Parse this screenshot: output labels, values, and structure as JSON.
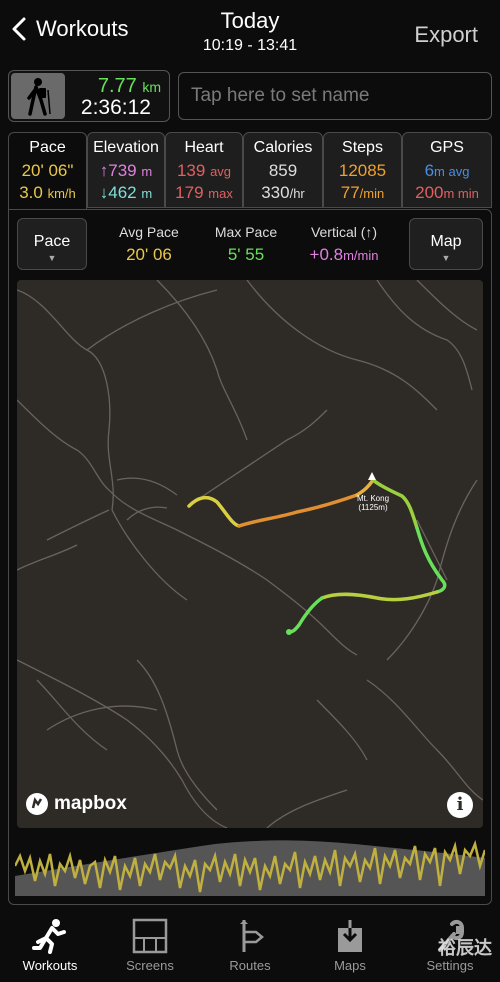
{
  "nav": {
    "back_label": "Workouts",
    "title": "Today",
    "time_range": "10:19 - 13:41",
    "export_label": "Export"
  },
  "summary": {
    "distance": "7.77",
    "distance_unit": "km",
    "duration": "2:36:12",
    "name_placeholder": "Tap here to set name"
  },
  "tabs": [
    {
      "title": "Pace",
      "l1": "20' 06\"",
      "l1_unit": "",
      "l2": "3.0",
      "l2_unit": "km/h"
    },
    {
      "title": "Elevation",
      "l1": "↑739",
      "l1_unit": "m",
      "l2": "↓462",
      "l2_unit": "m"
    },
    {
      "title": "Heart",
      "l1": "139",
      "l1_unit": "avg",
      "l2": "179",
      "l2_unit": "max"
    },
    {
      "title": "Calories",
      "l1": "859",
      "l1_unit": "",
      "l2": "330",
      "l2_unit": "/hr"
    },
    {
      "title": "Steps",
      "l1": "12085",
      "l1_unit": "",
      "l2": "77",
      "l2_unit": "/min"
    },
    {
      "title": "GPS",
      "l1": "6",
      "l1_unit": "m avg",
      "l2": "200",
      "l2_unit": "m min"
    }
  ],
  "panel": {
    "left_selector": "Pace",
    "right_selector": "Map",
    "avg_pace_label": "Avg Pace",
    "avg_pace": "20' 06",
    "max_pace_label": "Max Pace",
    "max_pace": "5' 55",
    "vertical_label": "Vertical (↑)",
    "vertical_value": "+0.8",
    "vertical_unit": "m/min"
  },
  "map": {
    "peak_name": "Mt. Kong",
    "peak_elev": "(1125m)",
    "attribution": "mapbox",
    "info_glyph": "i"
  },
  "tabbar": [
    {
      "label": "Workouts",
      "icon": "runner-icon"
    },
    {
      "label": "Screens",
      "icon": "screens-icon"
    },
    {
      "label": "Routes",
      "icon": "signpost-icon"
    },
    {
      "label": "Maps",
      "icon": "map-download-icon"
    },
    {
      "label": "Settings",
      "icon": "wrench-icon"
    }
  ],
  "watermark": "裕辰达",
  "colors": {
    "accent_green": "#68e05a",
    "pace_yellow": "#e8c84a",
    "heart_red": "#e06060",
    "steps_orange": "#f0a030",
    "gps_blue": "#4a8ee0",
    "vertical_purple": "#e080e0",
    "map_bg": "#2e2a26"
  }
}
